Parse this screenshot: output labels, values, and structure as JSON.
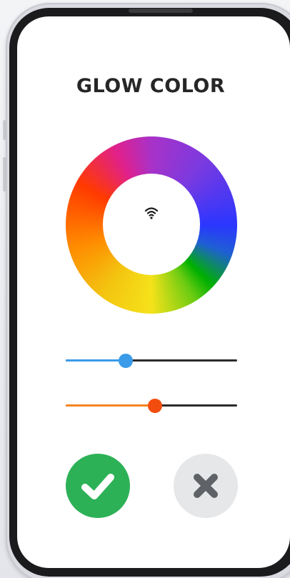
{
  "screen": {
    "title": "GLOW COLOR"
  },
  "color_wheel": {
    "center_icon": "wifi-icon",
    "hue_colors": [
      "#a832c8",
      "#2b36ff",
      "#00b000",
      "#f5e21a",
      "#ff8a00",
      "#ff3a00"
    ]
  },
  "sliders": [
    {
      "name": "blue-slider",
      "fill_color": "#3a9be8",
      "thumb_color": "#3a9be8",
      "fraction": 0.35
    },
    {
      "name": "orange-slider",
      "fill_color": "#f5841f",
      "thumb_color": "#f24d0e",
      "fraction": 0.52
    }
  ],
  "actions": {
    "confirm": {
      "icon": "check-icon",
      "color": "#2db157"
    },
    "cancel": {
      "icon": "close-icon",
      "color": "#e6e7e9"
    }
  }
}
